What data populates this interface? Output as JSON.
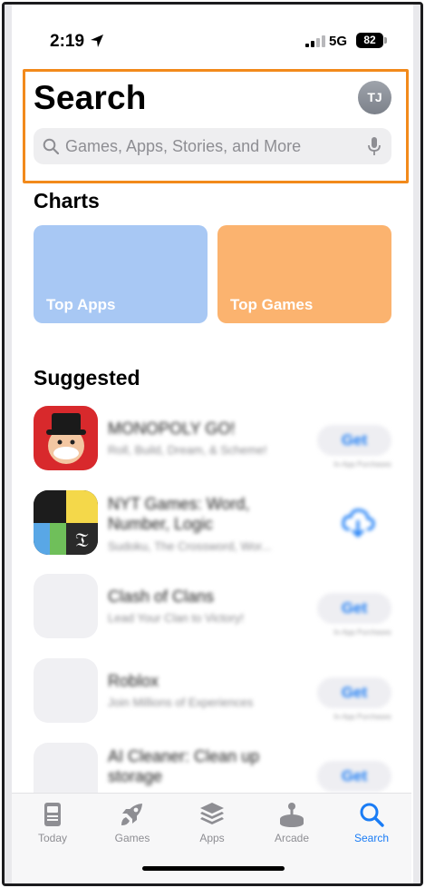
{
  "status": {
    "time": "2:19",
    "network": "5G",
    "battery": "82"
  },
  "header": {
    "title": "Search",
    "avatar_initials": "TJ",
    "search_placeholder": "Games, Apps, Stories, and More"
  },
  "charts": {
    "title": "Charts",
    "cards": [
      {
        "label": "Top Apps",
        "color": "#a8c8f4"
      },
      {
        "label": "Top Games",
        "color": "#fbb36f"
      }
    ]
  },
  "suggested": {
    "title": "Suggested",
    "apps": [
      {
        "name": "MONOPOLY GO!",
        "subtitle": "Roll, Build, Dream, & Scheme!",
        "action": "Get",
        "iap": "In-App Purchases"
      },
      {
        "name": "NYT Games: Word, Number, Logic",
        "subtitle": "Sudoku, The Crossword, Wor...",
        "action": "download"
      },
      {
        "name": "Clash of Clans",
        "subtitle": "Lead Your Clan to Victory!",
        "action": "Get",
        "iap": "In-App Purchases"
      },
      {
        "name": "Roblox",
        "subtitle": "Join Millions of Experiences",
        "action": "Get",
        "iap": "In-App Purchases"
      },
      {
        "name": "AI Cleaner: Clean up storage",
        "subtitle": "",
        "action": "Get"
      }
    ]
  },
  "tabbar": {
    "tabs": [
      {
        "label": "Today",
        "icon": "today-icon"
      },
      {
        "label": "Games",
        "icon": "rocket-icon"
      },
      {
        "label": "Apps",
        "icon": "stack-icon"
      },
      {
        "label": "Arcade",
        "icon": "joystick-icon"
      },
      {
        "label": "Search",
        "icon": "search-icon",
        "active": true
      }
    ]
  },
  "colors": {
    "accent": "#1a7cf5",
    "highlight": "#f28a1b"
  }
}
